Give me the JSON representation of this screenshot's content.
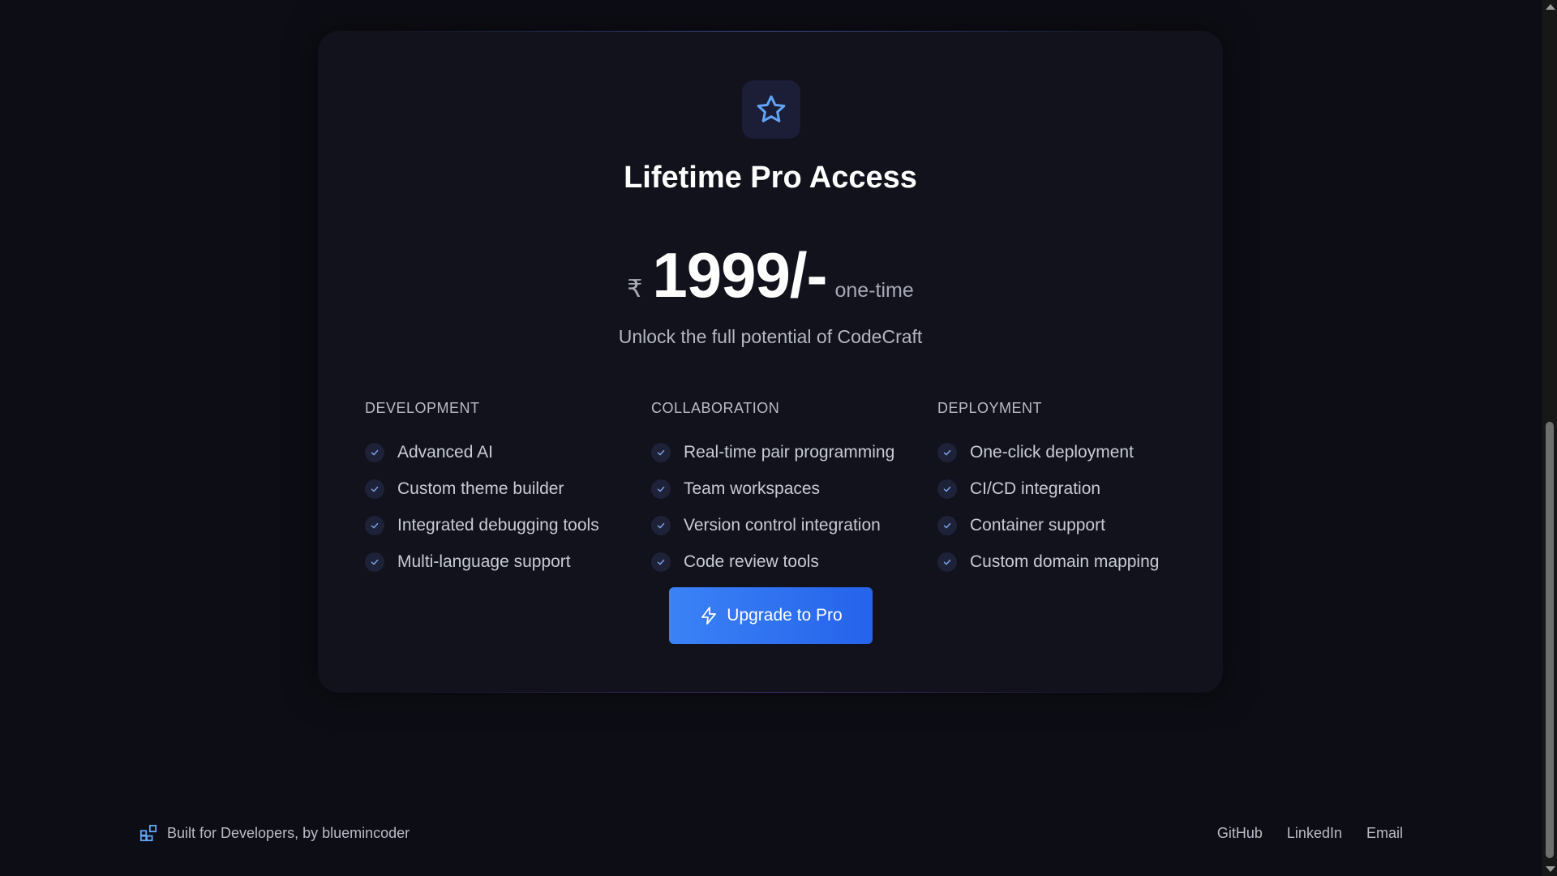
{
  "plan": {
    "title": "Lifetime Pro Access",
    "currency": "₹",
    "amount": "1999/-",
    "period": "one-time",
    "tagline": "Unlock the full potential of CodeCraft",
    "icon": "star-icon"
  },
  "features": [
    {
      "title": "DEVELOPMENT",
      "items": [
        "Advanced AI",
        "Custom theme builder",
        "Integrated debugging tools",
        "Multi-language support"
      ]
    },
    {
      "title": "COLLABORATION",
      "items": [
        "Real-time pair programming",
        "Team workspaces",
        "Version control integration",
        "Code review tools"
      ]
    },
    {
      "title": "DEPLOYMENT",
      "items": [
        "One-click deployment",
        "CI/CD integration",
        "Container support",
        "Custom domain mapping"
      ]
    }
  ],
  "cta": {
    "label": "Upgrade to Pro",
    "icon": "lightning-icon"
  },
  "footer": {
    "credit": "Built for Developers, by bluemincoder",
    "links": [
      "GitHub",
      "LinkedIn",
      "Email"
    ]
  },
  "colors": {
    "background": "#0d0d15",
    "card": "#11121c",
    "accent": "#3b82f6",
    "icon_blue": "#60a5fa"
  }
}
